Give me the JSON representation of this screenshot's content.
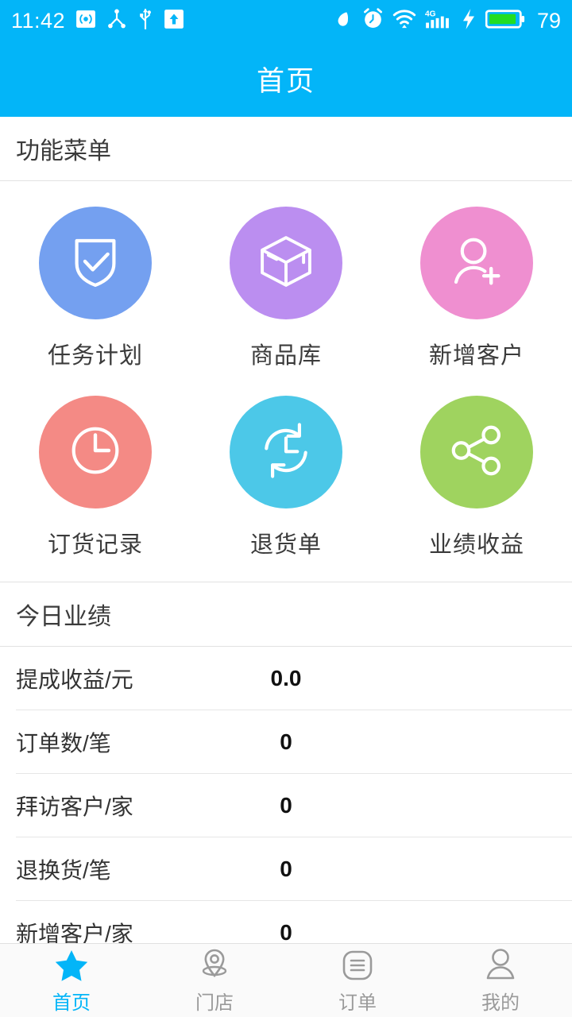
{
  "status_bar": {
    "time": "11:42",
    "battery_percent": "79",
    "left_icons": [
      "hotspot-icon",
      "bluetooth-share-icon",
      "usb-icon",
      "upload-arrow-icon"
    ],
    "right_icons": [
      "mute-icon",
      "alarm-clock-icon",
      "wifi-icon",
      "signal-4g-icon",
      "charging-bolt-icon",
      "battery-icon"
    ],
    "network_label": "4G",
    "background_color": "#03b5f8"
  },
  "header": {
    "title": "首页",
    "background_color": "#03b5f8",
    "text_color": "#ffffff"
  },
  "menu_section": {
    "title": "功能菜单",
    "items": [
      {
        "label": "任务计划",
        "icon": "shield-check-icon",
        "color": "#74a0f0"
      },
      {
        "label": "商品库",
        "icon": "box-3d-icon",
        "color": "#bb8ef0"
      },
      {
        "label": "新增客户",
        "icon": "user-plus-icon",
        "color": "#ef8fd0"
      },
      {
        "label": "订货记录",
        "icon": "clock-icon",
        "color": "#f48a85"
      },
      {
        "label": "退货单",
        "icon": "refresh-clock-icon",
        "color": "#4cc8e8"
      },
      {
        "label": "业绩收益",
        "icon": "share-nodes-icon",
        "color": "#9fd35f"
      }
    ]
  },
  "performance_section": {
    "title": "今日业绩",
    "rows": [
      {
        "label": "提成收益/元",
        "value": "0.0"
      },
      {
        "label": "订单数/笔",
        "value": "0"
      },
      {
        "label": "拜访客户/家",
        "value": "0"
      },
      {
        "label": "退换货/笔",
        "value": "0"
      },
      {
        "label": "新增客户/家",
        "value": "0"
      }
    ]
  },
  "tab_bar": {
    "active_color": "#03b5f8",
    "inactive_color": "#9a9a9a",
    "tabs": [
      {
        "label": "首页",
        "icon": "star-icon",
        "active": true
      },
      {
        "label": "门店",
        "icon": "location-pin-icon",
        "active": false
      },
      {
        "label": "订单",
        "icon": "list-icon",
        "active": false
      },
      {
        "label": "我的",
        "icon": "person-icon",
        "active": false
      }
    ]
  }
}
